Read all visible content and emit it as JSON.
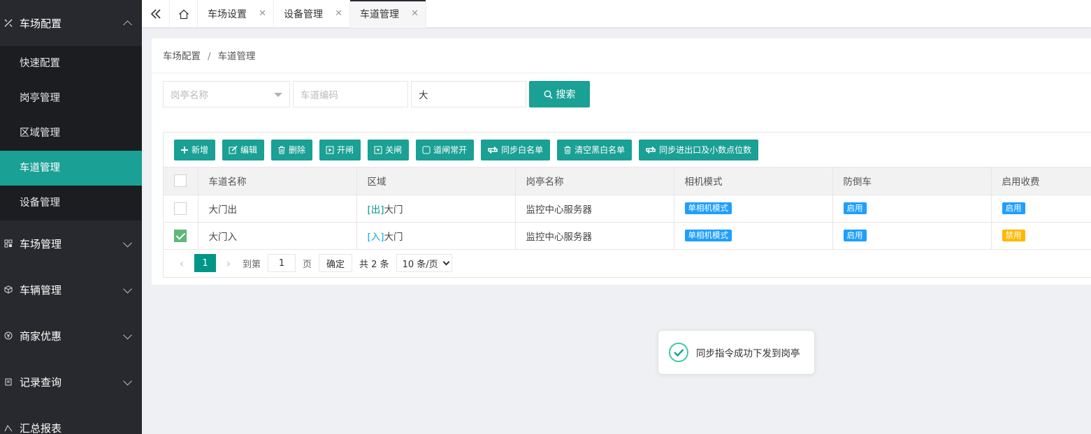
{
  "sidebar": {
    "groups": [
      {
        "label": "车场配置",
        "icon": "tools-icon",
        "expanded": true
      },
      {
        "label": "车场管理",
        "icon": "grid-icon",
        "expanded": false
      },
      {
        "label": "车辆管理",
        "icon": "cube-icon",
        "expanded": false
      },
      {
        "label": "商家优惠",
        "icon": "yen-icon",
        "expanded": false
      },
      {
        "label": "记录查询",
        "icon": "clipboard-icon",
        "expanded": false
      },
      {
        "label": "汇总报表",
        "icon": "chart-icon",
        "expanded": false
      }
    ],
    "sub_items": [
      "快速配置",
      "岗亭管理",
      "区域管理",
      "车道管理",
      "设备管理"
    ],
    "active_sub": "车道管理"
  },
  "tabs": {
    "items": [
      {
        "label": "车场设置",
        "close": "✕"
      },
      {
        "label": "设备管理",
        "close": "✕"
      },
      {
        "label": "车道管理",
        "close": "✕"
      }
    ],
    "active": "车道管理"
  },
  "breadcrumb": {
    "parent": "车场配置",
    "sep": "/",
    "current": "车道管理"
  },
  "filters": {
    "booth_placeholder": "岗亭名称",
    "lane_code_placeholder": "车道编码",
    "keyword_value": "大",
    "search_label": "搜索"
  },
  "toolbar": {
    "add": "新增",
    "edit": "编辑",
    "delete": "删除",
    "open": "开闸",
    "close": "关闸",
    "always_open": "道闸常开",
    "sync_white": "同步白名单",
    "clear_blackwhite": "清空黑白名单",
    "sync_io": "同步进出口及小数点位数"
  },
  "table": {
    "columns": [
      "车道名称",
      "区域",
      "岗亭名称",
      "相机模式",
      "防倒车",
      "启用收费"
    ],
    "rows": [
      {
        "checked": false,
        "name": "大门出",
        "area_tag": "[出]",
        "area": "大门",
        "booth": "监控中心服务器",
        "camera": "单相机模式",
        "anti_reverse": "启用",
        "charge": "启用",
        "charge_color": "#1e9fff"
      },
      {
        "checked": true,
        "name": "大门入",
        "area_tag": "[入]",
        "area": "大门",
        "booth": "监控中心服务器",
        "camera": "单相机模式",
        "anti_reverse": "启用",
        "charge": "禁用",
        "charge_color": "#ffb800"
      }
    ]
  },
  "pager": {
    "current": "1",
    "goto_label": "到第",
    "goto_value": "1",
    "page_label": "页",
    "confirm": "确定",
    "total": "共 2 条",
    "page_size": "10 条/页"
  },
  "toast": {
    "message": "同步指令成功下发到岗亭"
  },
  "colors": {
    "accent": "#1aa094",
    "sidebar_bg": "#28292e",
    "blue": "#1e9fff",
    "orange": "#ffb800"
  }
}
